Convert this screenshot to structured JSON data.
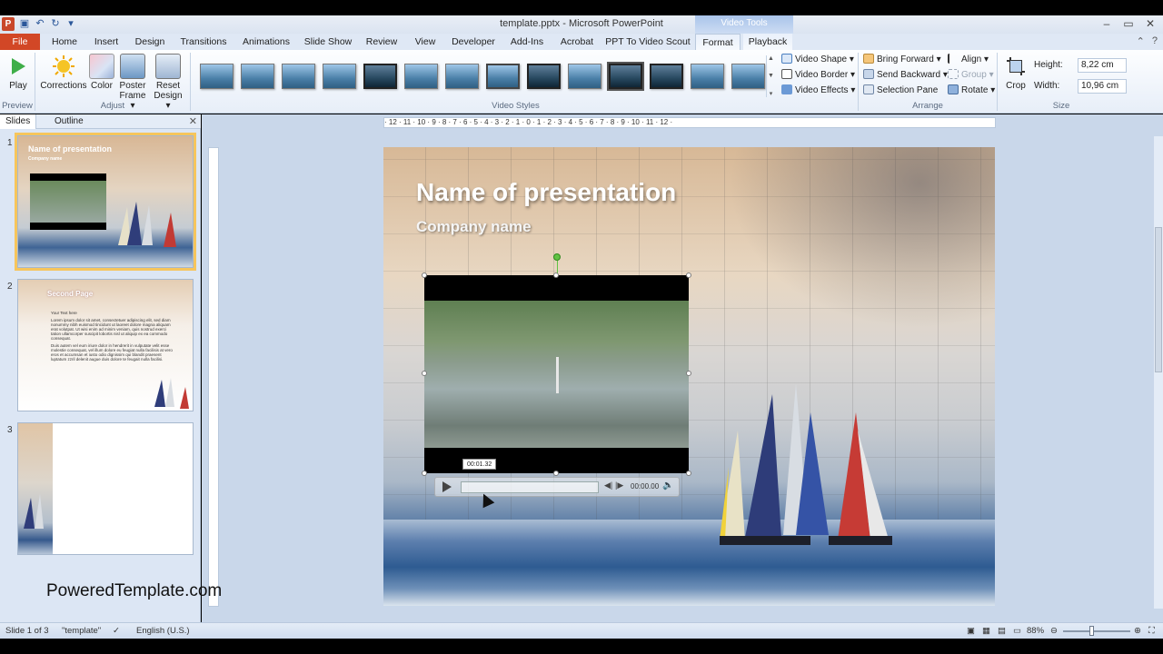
{
  "window": {
    "title": "template.pptx - Microsoft PowerPoint",
    "contextual_group": "Video Tools",
    "app_icon_letter": "P",
    "controls": [
      "–",
      "▭",
      "✕"
    ]
  },
  "tabs": [
    {
      "label": "File"
    },
    {
      "label": "Home"
    },
    {
      "label": "Insert"
    },
    {
      "label": "Design"
    },
    {
      "label": "Transitions"
    },
    {
      "label": "Animations"
    },
    {
      "label": "Slide Show"
    },
    {
      "label": "Review"
    },
    {
      "label": "View"
    },
    {
      "label": "Developer"
    },
    {
      "label": "Add-Ins"
    },
    {
      "label": "Acrobat"
    },
    {
      "label": "PPT To Video Scout"
    },
    {
      "label": "Format"
    },
    {
      "label": "Playback"
    }
  ],
  "ribbon": {
    "preview": {
      "play_label": "Play",
      "group": "Preview"
    },
    "adjust": {
      "corrections": "Corrections",
      "color": "Color",
      "poster_frame_1": "Poster",
      "poster_frame_2": "Frame ▾",
      "reset_design_1": "Reset",
      "reset_design_2": "Design ▾",
      "group": "Adjust"
    },
    "video_styles": {
      "group": "Video Styles",
      "video_shape": "Video Shape ▾",
      "video_border": "Video Border ▾",
      "video_effects": "Video Effects ▾"
    },
    "arrange": {
      "group": "Arrange",
      "bring_forward": "Bring Forward ▾",
      "send_backward": "Send Backward ▾",
      "selection_pane": "Selection Pane",
      "align": "Align ▾",
      "group_btn": "Group ▾",
      "rotate": "Rotate ▾"
    },
    "size": {
      "group": "Size",
      "crop": "Crop",
      "height_label": "Height:",
      "height_value": "8,22 cm",
      "width_label": "Width:",
      "width_value": "10,96 cm"
    }
  },
  "left_panel": {
    "tabs": [
      "Slides",
      "Outline"
    ],
    "slides": [
      {
        "number": "1",
        "title": "Name of presentation",
        "subtitle": "Company name"
      },
      {
        "number": "2",
        "title": "Second Page",
        "bullet1": "Your Text here",
        "bullet2": "Lorem ipsum dolor sit amet, consectetuer adipiscing elit, sed diam nonummy nibh euismod tincidunt ut laoreet dolore magna aliquam erat volutpat. Ut wisi enim ad minim veniam, quis nostrud exerci tation ullamcorper suscipit lobortis nisl ut aliquip ex ea commodo consequat.",
        "bullet3": "Duis autem vel eum iriure dolor in hendrerit in vulputate velit esse molestie consequat, vel illum dolore eu feugiat nulla facilisis at vero eros et accumsan et iusto odio dignissim qui blandit praesent luptatum zzril delenit augue duis dolore te feugait nulla facilisi."
      },
      {
        "number": "3"
      }
    ]
  },
  "ruler": {
    "ticks": "· 12 · 11 · 10 · 9 · 8 · 7 · 6 · 5 · 4 · 3 · 2 · 1 · 0 · 1 · 2 · 3 · 4 · 5 · 6 · 7 · 8 · 9 · 10 · 11 · 12 ·"
  },
  "slide": {
    "title": "Name of presentation",
    "subtitle": "Company name"
  },
  "video": {
    "tooltip_time": "00:01.32",
    "time": "00:00.00"
  },
  "watermark": "PoweredTemplate.com",
  "status": {
    "slide_info": "Slide 1 of 3",
    "theme": "\"template\"",
    "language": "English (U.S.)",
    "zoom": "88%"
  },
  "colors": {
    "file_tab": "#d24726",
    "ribbon_bg": "#e7eef8",
    "selection_outline": "#f6c55c"
  }
}
